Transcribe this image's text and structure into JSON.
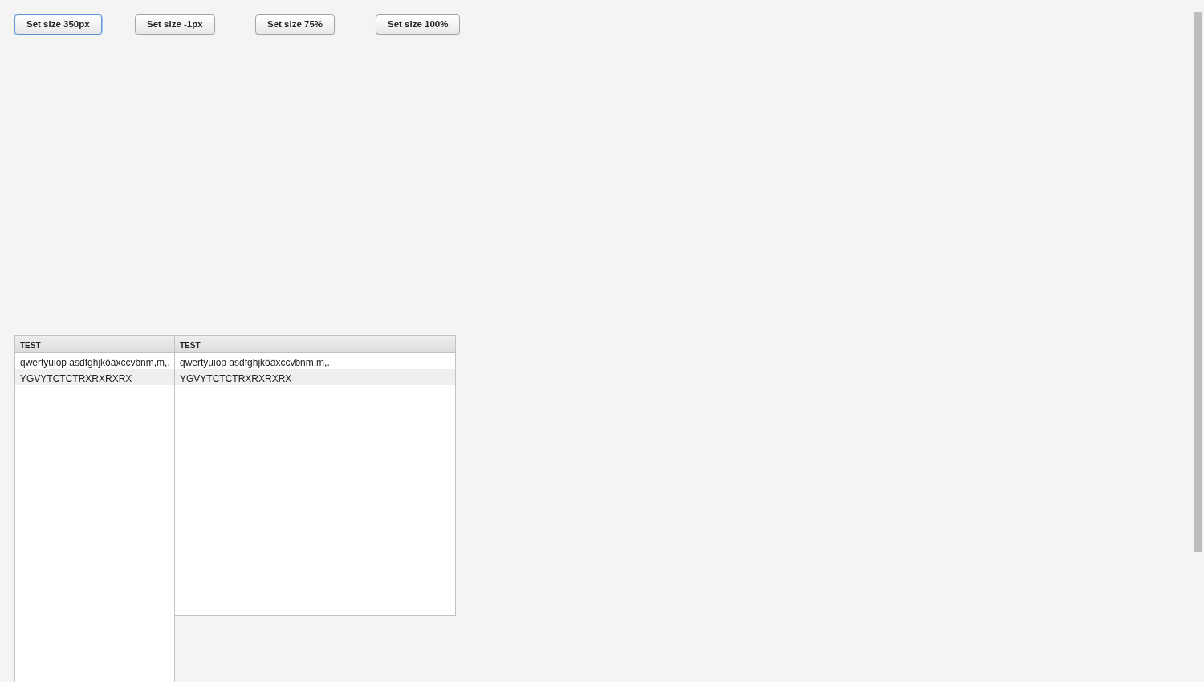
{
  "buttons": [
    {
      "label": "Set size 350px",
      "focused": true
    },
    {
      "label": "Set size -1px",
      "focused": false
    },
    {
      "label": "Set size 75%",
      "focused": false
    },
    {
      "label": "Set size 100%",
      "focused": false
    }
  ],
  "grids": [
    {
      "columns": [
        "TEST"
      ],
      "rows": [
        [
          "qwertyuiop asdfghjköäxccvbnm,m,."
        ],
        [
          "YGVYTCTCTRXRXRXRX"
        ]
      ]
    },
    {
      "columns": [
        "TEST"
      ],
      "rows": [
        [
          "qwertyuiop asdfghjköäxccvbnm,m,."
        ],
        [
          "YGVYTCTCTRXRXRXRX"
        ]
      ]
    }
  ]
}
